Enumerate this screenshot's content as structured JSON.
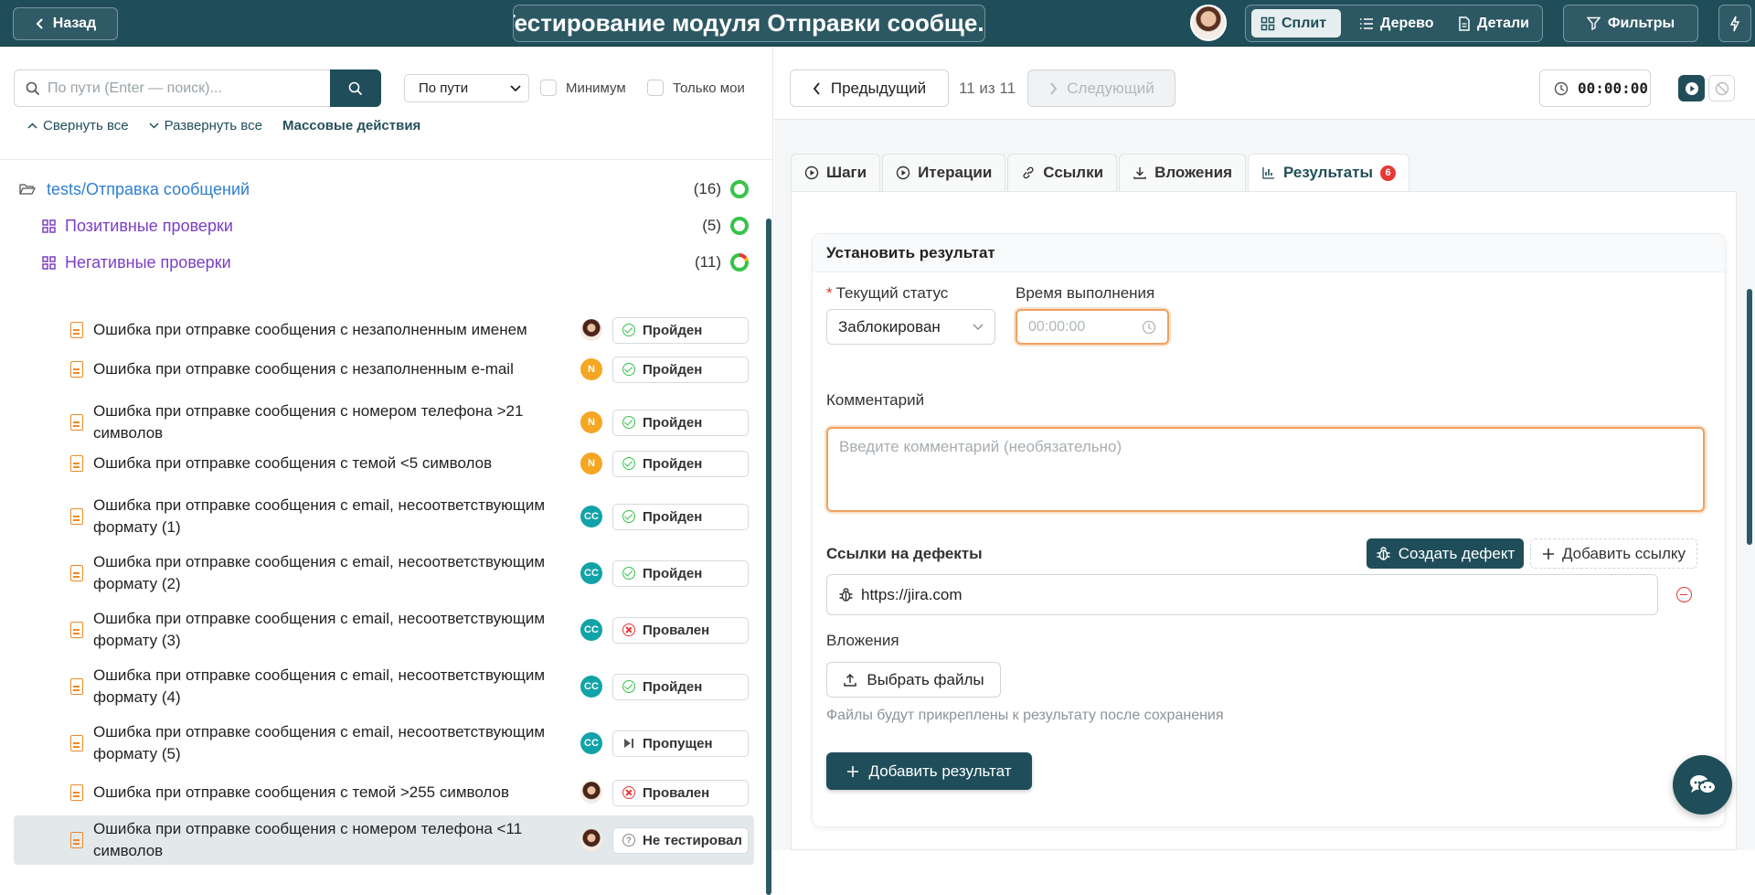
{
  "header": {
    "back_label": "Назад",
    "title": "Тестирование модуля Отправки сообще...",
    "views": [
      "Сплит",
      "Дерево",
      "Детали"
    ],
    "active_view": "Сплит",
    "filters_label": "Фильтры"
  },
  "left": {
    "search_placeholder": "По пути (Enter — поиск)...",
    "sort_select": "По пути",
    "check_minimum": "Минимум",
    "check_mine": "Только мои",
    "collapse_all": "Свернуть все",
    "expand_all": "Развернуть все",
    "bulk_actions": "Массовые действия",
    "folder": {
      "label": "tests/Отправка сообщений",
      "count": "(16)"
    },
    "groups": [
      {
        "label": "Позитивные проверки",
        "count": "(5)"
      },
      {
        "label": "Негативные проверки",
        "count": "(11)"
      }
    ],
    "cases": [
      {
        "title": "Ошибка при отправке сообщения с незаполненным именем",
        "avatar": "photo",
        "status": "Пройден",
        "kind": "pass"
      },
      {
        "title": "Ошибка при отправке сообщения с незаполненным e-mail",
        "avatar": "N",
        "status": "Пройден",
        "kind": "pass"
      },
      {
        "title": "Ошибка при отправке сообщения с номером телефона >21 символов",
        "avatar": "N",
        "status": "Пройден",
        "kind": "pass"
      },
      {
        "title": "Ошибка при отправке сообщения с темой <5 символов",
        "avatar": "N",
        "status": "Пройден",
        "kind": "pass"
      },
      {
        "title": "Ошибка при отправке сообщения с email, несоответствующим формату (1)",
        "avatar": "CC",
        "status": "Пройден",
        "kind": "pass"
      },
      {
        "title": "Ошибка при отправке сообщения с email, несоответствующим формату (2)",
        "avatar": "CC",
        "status": "Пройден",
        "kind": "pass"
      },
      {
        "title": "Ошибка при отправке сообщения с email, несоответствующим формату (3)",
        "avatar": "CC",
        "status": "Провален",
        "kind": "fail"
      },
      {
        "title": "Ошибка при отправке сообщения с email, несоответствующим формату (4)",
        "avatar": "CC",
        "status": "Пройден",
        "kind": "pass"
      },
      {
        "title": "Ошибка при отправке сообщения с email, несоответствующим формату (5)",
        "avatar": "CC",
        "status": "Пропущен",
        "kind": "skip"
      },
      {
        "title": "Ошибка при отправке сообщения с темой >255 символов",
        "avatar": "photo",
        "status": "Провален",
        "kind": "fail"
      },
      {
        "title": "Ошибка при отправке сообщения с номером телефона <11 символов",
        "avatar": "photo",
        "status": "Не тестировал",
        "kind": "q"
      }
    ]
  },
  "right": {
    "prev_label": "Предыдущий",
    "position": "11 из 11",
    "next_label": "Следующий",
    "timer": "00:00:00",
    "tabs": [
      "Шаги",
      "Итерации",
      "Ссылки",
      "Вложения",
      "Результаты"
    ],
    "results_badge": "6",
    "form": {
      "heading": "Установить результат",
      "status_label": "Текущий статус",
      "status_value": "Заблокирован",
      "time_label": "Время выполнения",
      "time_placeholder": "00:00:00",
      "comment_label": "Комментарий",
      "comment_placeholder": "Введите комментарий (необязательно)",
      "defects_label": "Ссылки на дефекты",
      "create_defect": "Создать дефект",
      "add_link": "Добавить ссылку",
      "defect_link": "https://jira.com",
      "attachments_label": "Вложения",
      "choose_files": "Выбрать файлы",
      "files_hint": "Файлы будут прикреплены к результату после сохранения",
      "add_result": "Добавить результат"
    }
  }
}
